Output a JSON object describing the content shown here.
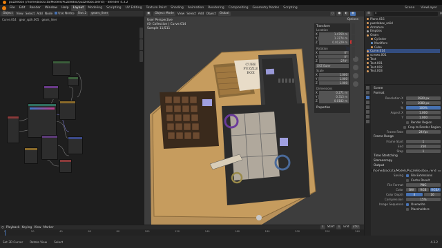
{
  "titlebar": {
    "title": "puzzlebox [/home/blackcta/Models/PuzzleBox/puzzlebox.blend] - Blender 4.3.2"
  },
  "menu": [
    "File",
    "Edit",
    "Render",
    "Window",
    "Help"
  ],
  "workspaces": [
    "Layout",
    "Modeling",
    "Sculpting",
    "UV Editing",
    "Texture Paint",
    "Shading",
    "Animation",
    "Rendering",
    "Compositing",
    "Geometry Nodes",
    "Scripting"
  ],
  "scene": {
    "name": "Scene",
    "view_layer": "ViewLayer"
  },
  "node_editor": {
    "editor": "Object",
    "view": "View",
    "select": "Select",
    "add": "Add",
    "node": "Node",
    "use_nodes": "Use Nodes",
    "slot": "Slot 2",
    "material": "gears_liner",
    "crumbs": [
      "Curve.014",
      "gear_spth.005",
      "gears_liner"
    ]
  },
  "node_panel": {
    "rows": [
      {
        "l": "Base Color",
        "v": ""
      },
      {
        "l": "Metallic",
        "v": "0.000"
      },
      {
        "l": "Roughness",
        "v": "0.500"
      },
      {
        "l": "IOR",
        "v": "1.450"
      },
      {
        "l": "Alpha",
        "v": "1.000"
      },
      {
        "l": "Normal",
        "v": ""
      }
    ]
  },
  "viewport": {
    "mode": "Object Mode",
    "view": "View",
    "select": "Select",
    "add": "Add",
    "object": "Object",
    "transform": "Global",
    "info1": "User Perspective",
    "info2": "(0) Collection | Curve.014",
    "info3": "Sample 11/511",
    "options": "Options"
  },
  "npanel": {
    "title": "Transform",
    "location_label": "Location",
    "loc": [
      {
        "a": "X",
        "v": "1.4769 m"
      },
      {
        "a": "Y",
        "v": "1.3774 m"
      },
      {
        "a": "Z",
        "v": "0.01229 m"
      }
    ],
    "rotation_label": "Rotation",
    "rot": [
      {
        "a": "X",
        "v": "0°"
      },
      {
        "a": "Y",
        "v": "0°"
      },
      {
        "a": "Z",
        "v": "-270°"
      }
    ],
    "euler": "XYZ Euler",
    "scale_label": "Scale",
    "scale": [
      {
        "a": "X",
        "v": "1.000"
      },
      {
        "a": "Y",
        "v": "1.000"
      },
      {
        "a": "Z",
        "v": "1.000"
      }
    ],
    "dim_label": "Dimensions",
    "dims": [
      {
        "a": "X",
        "v": "0.271 m"
      },
      {
        "a": "Y",
        "v": "0.313 m"
      },
      {
        "a": "Z",
        "v": "0.0182 m"
      }
    ],
    "properties": "Properties",
    "tabs": [
      "Item",
      "Tool",
      "View"
    ]
  },
  "box_label": {
    "l1": "CUBE",
    "l2": "PUZZLE",
    "l3": "BOX"
  },
  "outliner": {
    "items": [
      {
        "name": "Plane.015",
        "color": "#e0a060"
      },
      {
        "name": "puzzlebox_solid",
        "color": "#e0a060"
      },
      {
        "name": "Armature",
        "color": "#e08a40"
      },
      {
        "name": "Empties",
        "color": "#aaaaaa"
      },
      {
        "name": "Gears",
        "color": "#e0a060"
      },
      {
        "name": "Cylinder",
        "color": "#e0a060"
      },
      {
        "name": "Modifiers",
        "color": "#6da0e0"
      },
      {
        "name": "Cube",
        "color": "#e0a060"
      },
      {
        "name": "Curve.014",
        "color": "#e0a060"
      },
      {
        "name": "screws.001",
        "color": "#e0a060"
      },
      {
        "name": "Text",
        "color": "#e0a060"
      },
      {
        "name": "Text.001",
        "color": "#e0a060"
      },
      {
        "name": "Text.002",
        "color": "#e0a060"
      },
      {
        "name": "Text.003",
        "color": "#e0a060"
      }
    ]
  },
  "properties": {
    "scene": "Scene",
    "format_label": "Format",
    "rows": [
      {
        "l": "Resolution X",
        "v": "1920 px"
      },
      {
        "l": "Y",
        "v": "1080 px"
      },
      {
        "l": "%",
        "v": "100%"
      },
      {
        "l": "Aspect X",
        "v": "1.000"
      },
      {
        "l": "Y",
        "v": "1.000"
      },
      {
        "l": "Render Region",
        "v": ""
      },
      {
        "l": "Crop to Render Region",
        "v": ""
      },
      {
        "l": "Frame Rate",
        "v": "24 fps"
      }
    ],
    "frame_label": "Frame Range",
    "frames": [
      {
        "l": "Frame Start",
        "v": "1"
      },
      {
        "l": "End",
        "v": "250"
      },
      {
        "l": "Step",
        "v": "1"
      }
    ],
    "time_stretch": "Time Stretching",
    "stereo": "Stereoscopy",
    "output_label": "Output",
    "output_path": "/home/blackcta/Models/PuzzleBox/box_rend...",
    "saving": "Saving",
    "file_ext": "File Extensions",
    "cache": "Cache Result",
    "file_format_label": "File Format",
    "file_format": "PNG",
    "color_label": "Color",
    "color_opts": [
      "BW",
      "RGB",
      "RGBA"
    ],
    "depth_label": "Color Depth",
    "depth_opts": [
      "8",
      "16"
    ],
    "compression_label": "Compression",
    "compression": "15%",
    "img_seq": "Image Sequence",
    "overwrite": "Overwrite",
    "placeholders": "Placeholders"
  },
  "timeline": {
    "playback": "Playback",
    "keying": "Keying",
    "view": "View",
    "marker": "Marker",
    "frame": "1",
    "start": "Start",
    "start_v": "1",
    "end": "End",
    "end_v": "250",
    "ticks": [
      "0",
      "20",
      "40",
      "60",
      "80",
      "100",
      "120",
      "140",
      "160",
      "180",
      "200",
      "220",
      "240"
    ]
  },
  "status": {
    "left": "Set 3D Cursor",
    "mid": "Rotate View",
    "right": "Select",
    "version": "4.3.2"
  },
  "colors": {
    "accent": "#4772b3",
    "wood": "#c69c5e",
    "dark_wood": "#6b4f2e"
  }
}
